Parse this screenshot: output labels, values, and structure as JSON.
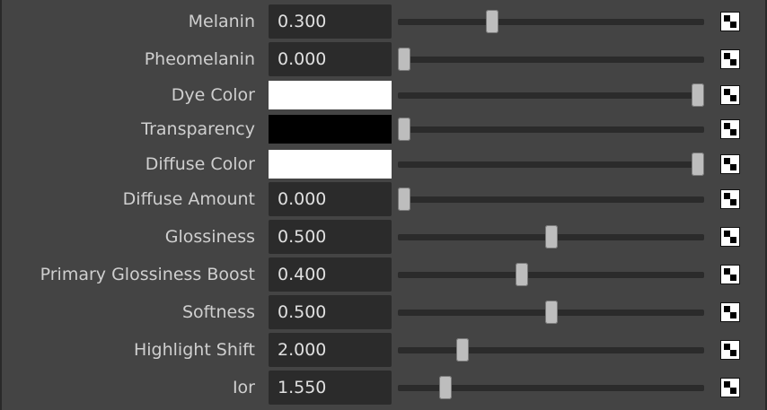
{
  "panel": {
    "attributes": [
      {
        "label": "Melanin",
        "type": "number",
        "value": "0.300",
        "slider_fraction": 0.3
      },
      {
        "label": "Pheomelanin",
        "type": "number",
        "value": "0.000",
        "slider_fraction": 0.0
      },
      {
        "label": "Dye Color",
        "type": "color",
        "color": "#ffffff",
        "slider_fraction": 1.0
      },
      {
        "label": "Transparency",
        "type": "color",
        "color": "#000000",
        "slider_fraction": 0.0
      },
      {
        "label": "Diffuse Color",
        "type": "color",
        "color": "#ffffff",
        "slider_fraction": 1.0
      },
      {
        "label": "Diffuse Amount",
        "type": "number",
        "value": "0.000",
        "slider_fraction": 0.0
      },
      {
        "label": "Glossiness",
        "type": "number",
        "value": "0.500",
        "slider_fraction": 0.5
      },
      {
        "label": "Primary Glossiness Boost",
        "type": "number",
        "value": "0.400",
        "slider_fraction": 0.4
      },
      {
        "label": "Softness",
        "type": "number",
        "value": "0.500",
        "slider_fraction": 0.5
      },
      {
        "label": "Highlight Shift",
        "type": "number",
        "value": "2.000",
        "slider_fraction": 0.2
      },
      {
        "label": "Ior",
        "type": "number",
        "value": "1.550",
        "slider_fraction": 0.14
      }
    ],
    "map_button_icon": "checker-map-icon"
  },
  "colors": {
    "background": "#444444",
    "field": "#2b2b2b",
    "label": "#cfcfcf",
    "handle": "#bdbdbd"
  }
}
